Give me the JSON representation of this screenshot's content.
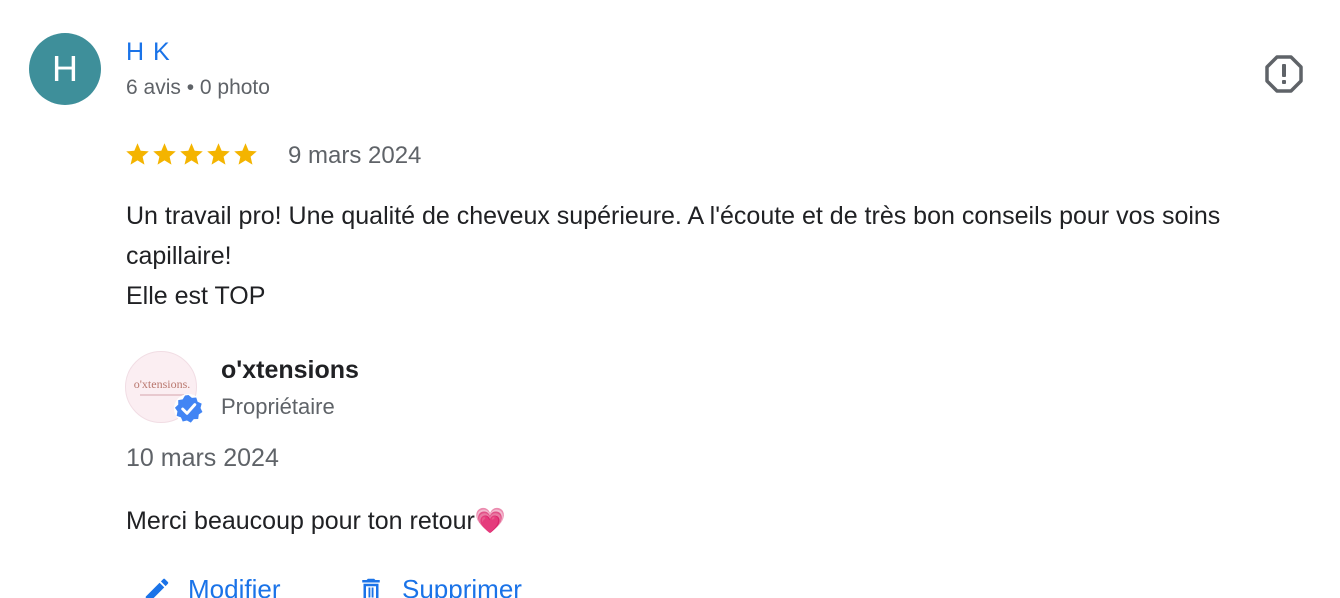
{
  "review": {
    "avatar_initial": "H",
    "avatar_color": "#3e8f9a",
    "reviewer_name": "H K",
    "reviewer_meta": "6 avis • 0 photo",
    "rating": 5,
    "rating_max": 5,
    "date": "9 mars 2024",
    "text_lines": [
      "Un travail pro! Une qualité de cheveux supérieure. A l'écoute et de très bon conseils pour vos soins capillaire!",
      "Elle est TOP"
    ],
    "flag_icon": "report-flag-icon"
  },
  "owner_response": {
    "logo_text": "o'xtensions.",
    "name": "o'xtensions",
    "role": "Propriétaire",
    "verified_icon": "verified-badge-icon",
    "date": "10 mars 2024",
    "text": "Merci beaucoup pour ton retour💗"
  },
  "actions": {
    "edit_label": "Modifier",
    "edit_icon": "pencil-icon",
    "delete_label": "Supprimer",
    "delete_icon": "trash-icon"
  },
  "colors": {
    "link_blue": "#1a73e8",
    "star_gold": "#f4b400",
    "text_primary": "#202124",
    "text_secondary": "#5f6368"
  }
}
